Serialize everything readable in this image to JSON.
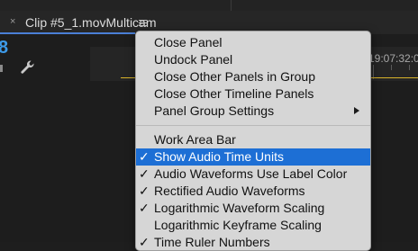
{
  "panel": {
    "close_glyph": "×",
    "tab_title": "Clip #5_1.movMulticam",
    "menu_icon": "hamburger-icon",
    "timecode_fragment": "8",
    "ruler_timecode": "19:07:32:00",
    "accent_color": "#4a7fd6",
    "timecode_color": "#3d9ae8",
    "playhead_color": "#d9b42a"
  },
  "menu": {
    "highlight_color": "#1d6fd5",
    "groups": [
      {
        "items": [
          {
            "label": "Close Panel",
            "checked": false,
            "submenu": false
          },
          {
            "label": "Undock Panel",
            "checked": false,
            "submenu": false
          },
          {
            "label": "Close Other Panels in Group",
            "checked": false,
            "submenu": false
          },
          {
            "label": "Close Other Timeline Panels",
            "checked": false,
            "submenu": false
          },
          {
            "label": "Panel Group Settings",
            "checked": false,
            "submenu": true
          }
        ]
      },
      {
        "items": [
          {
            "label": "Work Area Bar",
            "checked": false,
            "submenu": false
          },
          {
            "label": "Show Audio Time Units",
            "checked": true,
            "submenu": false,
            "highlighted": true
          },
          {
            "label": "Audio Waveforms Use Label Color",
            "checked": true,
            "submenu": false
          },
          {
            "label": "Rectified Audio Waveforms",
            "checked": true,
            "submenu": false
          },
          {
            "label": "Logarithmic Waveform Scaling",
            "checked": true,
            "submenu": false
          },
          {
            "label": "Logarithmic Keyframe Scaling",
            "checked": false,
            "submenu": false
          },
          {
            "label": "Time Ruler Numbers",
            "checked": true,
            "submenu": false
          }
        ]
      }
    ]
  },
  "check_glyph": "✓"
}
